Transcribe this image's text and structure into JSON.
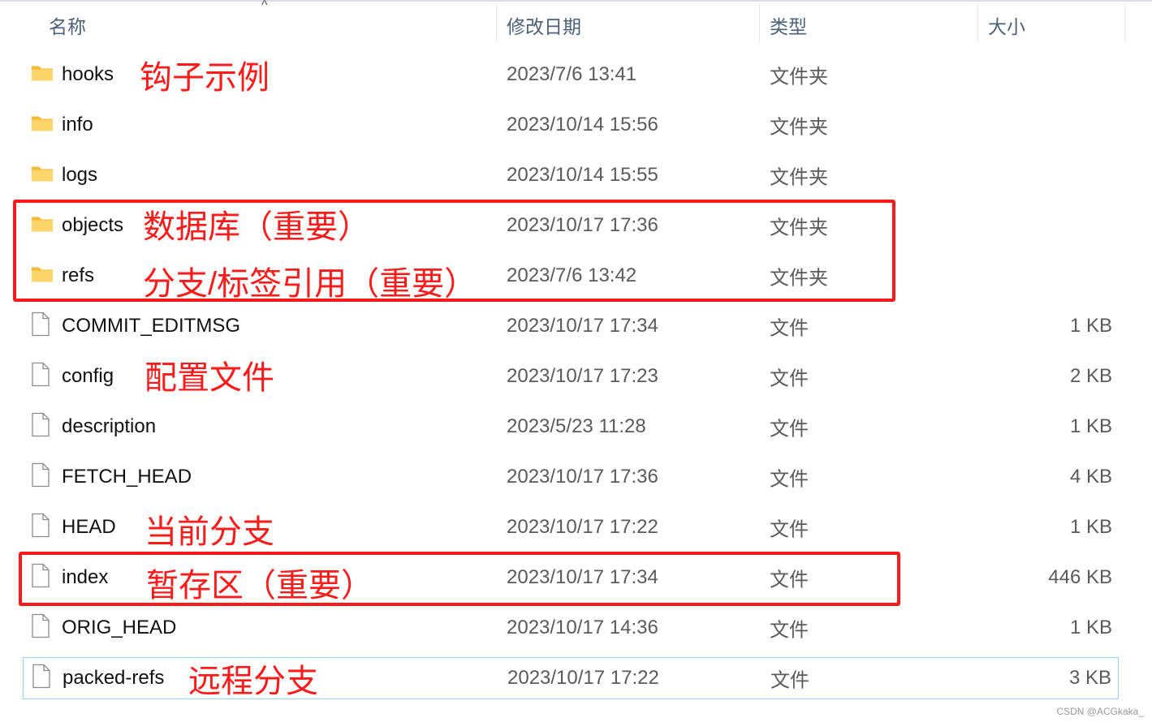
{
  "columns": {
    "name": "名称",
    "date": "修改日期",
    "type": "类型",
    "size": "大小"
  },
  "rows": [
    {
      "name": "hooks",
      "date": "2023/7/6 13:41",
      "type": "文件夹",
      "size": "",
      "icon": "folder-icon"
    },
    {
      "name": "info",
      "date": "2023/10/14 15:56",
      "type": "文件夹",
      "size": "",
      "icon": "folder-icon"
    },
    {
      "name": "logs",
      "date": "2023/10/14 15:55",
      "type": "文件夹",
      "size": "",
      "icon": "folder-icon"
    },
    {
      "name": "objects",
      "date": "2023/10/17 17:36",
      "type": "文件夹",
      "size": "",
      "icon": "folder-icon"
    },
    {
      "name": "refs",
      "date": "2023/7/6 13:42",
      "type": "文件夹",
      "size": "",
      "icon": "folder-icon"
    },
    {
      "name": "COMMIT_EDITMSG",
      "date": "2023/10/17 17:34",
      "type": "文件",
      "size": "1 KB",
      "icon": "file-icon"
    },
    {
      "name": "config",
      "date": "2023/10/17 17:23",
      "type": "文件",
      "size": "2 KB",
      "icon": "file-icon"
    },
    {
      "name": "description",
      "date": "2023/5/23 11:28",
      "type": "文件",
      "size": "1 KB",
      "icon": "file-icon"
    },
    {
      "name": "FETCH_HEAD",
      "date": "2023/10/17 17:36",
      "type": "文件",
      "size": "4 KB",
      "icon": "file-icon"
    },
    {
      "name": "HEAD",
      "date": "2023/10/17 17:22",
      "type": "文件",
      "size": "1 KB",
      "icon": "file-icon"
    },
    {
      "name": "index",
      "date": "2023/10/17 17:34",
      "type": "文件",
      "size": "446 KB",
      "icon": "file-icon"
    },
    {
      "name": "ORIG_HEAD",
      "date": "2023/10/17 14:36",
      "type": "文件",
      "size": "1 KB",
      "icon": "file-icon"
    },
    {
      "name": "packed-refs",
      "date": "2023/10/17 17:22",
      "type": "文件",
      "size": "3 KB",
      "icon": "file-icon"
    }
  ],
  "annotations": {
    "hooks": "钩子示例",
    "objects": "数据库（重要）",
    "refs": "分支/标签引用（重要）",
    "config": "配置文件",
    "head": "当前分支",
    "index": "暂存区（重要）",
    "packed_refs": "远程分支"
  },
  "colors": {
    "annotation": "#ff1a1a",
    "selection": "#99d1ff",
    "folder": "#f8c845"
  },
  "watermark": "CSDN @ACGkaka_"
}
